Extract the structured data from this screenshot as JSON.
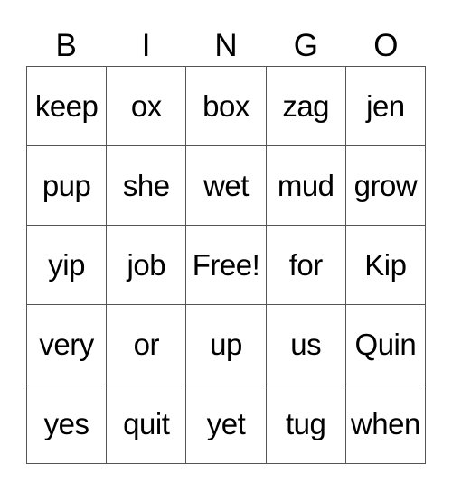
{
  "header": {
    "letters": [
      "B",
      "I",
      "N",
      "G",
      "O"
    ]
  },
  "board": {
    "rows": [
      [
        "keep",
        "ox",
        "box",
        "zag",
        "jen"
      ],
      [
        "pup",
        "she",
        "wet",
        "mud",
        "grow"
      ],
      [
        "yip",
        "job",
        "Free!",
        "for",
        "Kip"
      ],
      [
        "very",
        "or",
        "up",
        "us",
        "Quin"
      ],
      [
        "yes",
        "quit",
        "yet",
        "tug",
        "when"
      ]
    ]
  }
}
